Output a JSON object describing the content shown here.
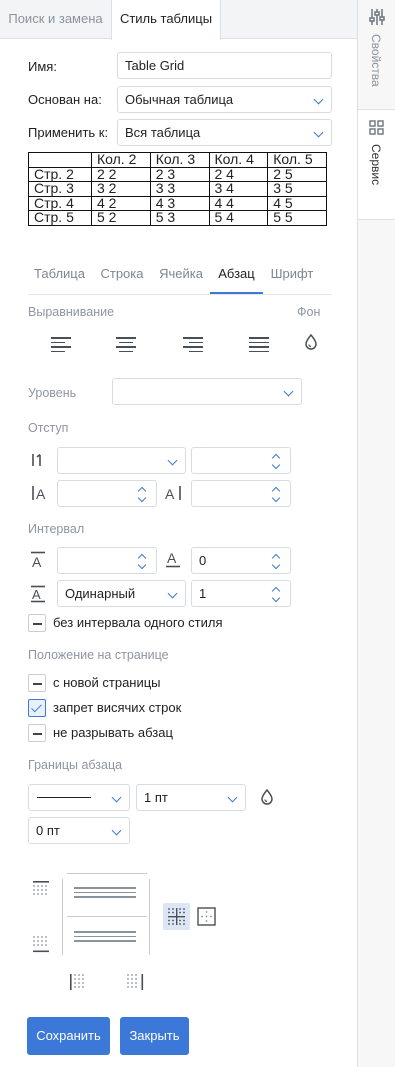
{
  "tabs": {
    "find_replace": "Поиск и замена",
    "table_style": "Стиль таблицы"
  },
  "side_panel": {
    "properties": "Свойства",
    "service": "Сервис"
  },
  "form": {
    "name_label": "Имя:",
    "name_value": "Table Grid",
    "based_on_label": "Основан на:",
    "based_on_value": "Обычная таблица",
    "apply_to_label": "Применить к:",
    "apply_to_value": "Вся таблица"
  },
  "preview_table": {
    "header": [
      "",
      "Кол. 2",
      "Кол. 3",
      "Кол. 4",
      "Кол. 5"
    ],
    "rows": [
      [
        "Стр. 2",
        "2 2",
        "2 3",
        "2 4",
        "2 5"
      ],
      [
        "Стр. 3",
        "3 2",
        "3 3",
        "3 4",
        "3 5"
      ],
      [
        "Стр. 4",
        "4 2",
        "4 3",
        "4 4",
        "4 5"
      ],
      [
        "Стр. 5",
        "5 2",
        "5 3",
        "5 4",
        "5 5"
      ]
    ]
  },
  "subtabs": {
    "table": "Таблица",
    "row": "Строка",
    "cell": "Ячейка",
    "paragraph": "Абзац",
    "font": "Шрифт",
    "active": "paragraph"
  },
  "paragraph": {
    "alignment_label": "Выравнивание",
    "background_label": "Фон",
    "level_label": "Уровень",
    "level_value": "",
    "indent_label": "Отступ",
    "spacing_label": "Интервал",
    "spacing_after_value": "0",
    "line_spacing_type": "Одинарный",
    "line_spacing_value": "1",
    "no_spacing_same_style": "без интервала одного стиля",
    "page_position_label": "Положение на странице",
    "page_break_before": "с новой страницы",
    "widow_control": "запрет висячих строк",
    "keep_lines_together": "не разрывать абзац",
    "checkbox_states": {
      "no_spacing_same_style": false,
      "page_break_before": false,
      "widow_control": true,
      "keep_lines_together": false
    },
    "borders_label": "Границы абзаца",
    "border_width": "1 пт",
    "border_spacing": "0 пт"
  },
  "buttons": {
    "save": "Сохранить",
    "close": "Закрыть"
  },
  "colors": {
    "accent": "#3b78d8",
    "sidebar_bg": "#f7f7f7",
    "border": "#d7dce3"
  }
}
